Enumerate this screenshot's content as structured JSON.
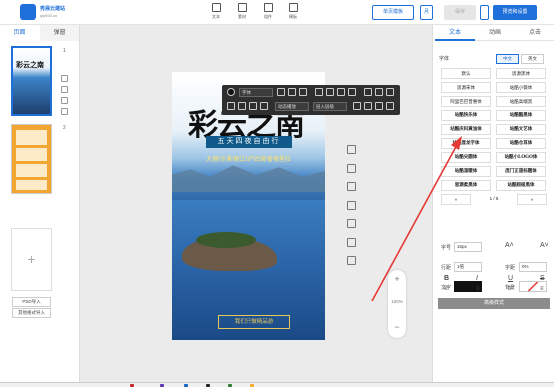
{
  "app": {
    "logo_name": "秀展云建站",
    "logo_sub": "qly592.cn"
  },
  "toolbar": {
    "items": [
      {
        "label": "文本",
        "icon": "text-icon"
      },
      {
        "label": "素材",
        "icon": "image-icon"
      },
      {
        "label": "组件",
        "icon": "widget-icon"
      },
      {
        "label": "模板",
        "icon": "template-icon"
      }
    ],
    "create_label": "单页模板",
    "month_label": "月",
    "disabled_label": "保存",
    "preview_label": "预览和设置"
  },
  "left_panel": {
    "tabs": [
      "页面",
      "弹窗"
    ],
    "page_numbers": [
      "1",
      "2"
    ],
    "import_psd": "PSD导入",
    "import_other": "其他格式导入"
  },
  "poster": {
    "en": "YUNNAN",
    "title": "彩云之南",
    "band": "五天四夜自由行",
    "sub": "大理/沙溪/丽江/泸沽湖/香格里拉",
    "cta": "我们只做精品游"
  },
  "float_toolbar": {
    "font_label": "字体",
    "anim_label": "动态播放",
    "layer_label": "层入层级"
  },
  "zoom": {
    "level": "100%"
  },
  "right_panel": {
    "tabs": [
      "文本",
      "动画",
      "点击"
    ],
    "font_label": "字体",
    "lang_options": [
      "中文",
      "英文"
    ],
    "fonts": [
      [
        "默认",
        "思源黑体"
      ],
      [
        "思源宋体",
        "站酷小薇体"
      ],
      [
        "阿里巴巴普惠体",
        "站酷高端黑"
      ],
      [
        "站酷快乐体",
        "站酷酷黑体"
      ],
      [
        "站酷庆科黄油体",
        "站酷文艺体"
      ],
      [
        "站酷显龙字体",
        "站酷仓耳体"
      ],
      [
        "站酷尖圆体",
        "站酷小LOGO体"
      ],
      [
        "站酷温暖体",
        "庞门正道标题体"
      ],
      [
        "思源柔黑体",
        "站酷超级黑体"
      ]
    ],
    "page_indicator": "1 / 5",
    "size_label": "字号",
    "size_value": "15px",
    "line_label": "行距",
    "line_value": "1倍",
    "letter_label": "字距",
    "letter_value": "0%",
    "color_label": "文字",
    "bg_label": "背景",
    "advanced": "高级样式"
  },
  "colors": {
    "accent": "#1e6fd9",
    "arrow": "#e53935"
  }
}
